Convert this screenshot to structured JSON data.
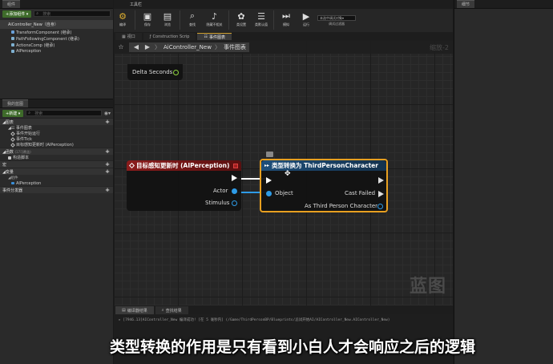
{
  "components": {
    "tab": "组件",
    "add_button": "+添加组件 ▾",
    "search_placeholder": "搜索",
    "root": "AiController_New（自身）",
    "items": [
      "TransformComponent (继承)",
      "PathFollowingComponent (继承)",
      "ActionsComp (继承)",
      "AIPerception"
    ]
  },
  "my_blueprint": {
    "tab": "我的蓝图",
    "new_button": "+新建 ▾",
    "search_placeholder": "搜索",
    "graphs_label": "◢图表",
    "event_graph_label": "◢☷ 事件图表",
    "events": [
      "事件开始运行",
      "事件Tick",
      "目标感知更新时 (AIPerception)"
    ],
    "functions_label": "◢函数",
    "functions_hint": "(17可覆盖)",
    "construction_script": "构造脚本",
    "macros_label": "宏",
    "variables_label": "◢变量",
    "components_label": "◢组件",
    "component_var": "AIPerception",
    "dispatchers_label": "事件分发器"
  },
  "toolbar": {
    "tab": "工具栏",
    "buttons": {
      "compile": "编译",
      "save": "保存",
      "browse": "浏览",
      "find": "查找",
      "hide_unrelated": "隐藏不相关",
      "class_settings": "类设置",
      "class_defaults": "类默认值",
      "simulate": "模拟",
      "play": "运行"
    },
    "debug_select": "未选中调试对象▾",
    "debug_label": "调试过滤器"
  },
  "doc_tabs": [
    "视口",
    "Construction Scrip",
    "事件图表"
  ],
  "graph": {
    "breadcrumb_root": "AiController_New",
    "breadcrumb_sep": "〉",
    "breadcrumb_current": "事件图表",
    "zoom": "缩放-2",
    "watermark": "蓝图",
    "delta_seconds": "Delta Seconds",
    "event_node": {
      "title": "目标感知更新时 (AIPerception)",
      "actor": "Actor",
      "stimulus": "Stimulus"
    },
    "cast_node": {
      "title": "类型转换为 ThirdPersonCharacter",
      "object": "Object",
      "cast_failed": "Cast Failed",
      "as_output": "As Third Person Character"
    },
    "colors": {
      "event_header": "#8b1c1c",
      "cast_header": "#1f4f7a",
      "cast_border": "#e8a020",
      "object_pin": "#2e9be6"
    }
  },
  "log": {
    "tabs": [
      "编译器结果",
      "查找结果"
    ],
    "line": "▸ [7946.13]AIController_New 编译成功! [在 5 毫秒内] (/Game/ThirdPersonBP/Blueprints/忌试开始AI/AIController_New.AIController_New)"
  },
  "details": {
    "tab": "细节"
  },
  "subtitle": "类型转换的作用是只有看到小白人才会响应之后的逻辑"
}
